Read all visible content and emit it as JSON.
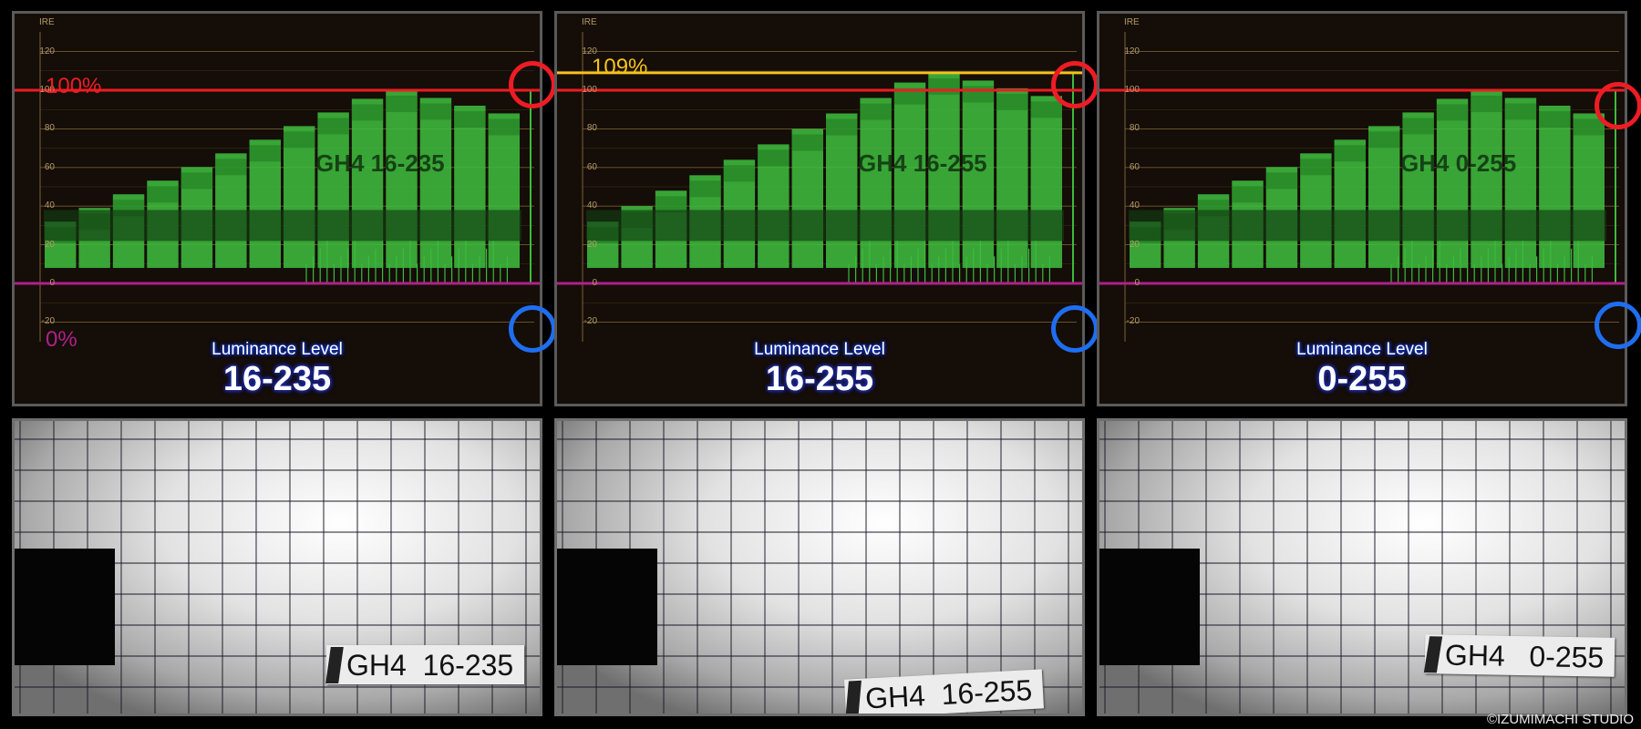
{
  "scope": {
    "axis_title": "IRE",
    "ticks": [
      "120",
      "100",
      "80",
      "60",
      "40",
      "20",
      "0",
      "-20"
    ],
    "luminance_label": "Luminance Level",
    "colors": {
      "waveform": "#3dbb3d",
      "white_line": "#ee1c24",
      "black_line": "#b0208c",
      "over_line": "#f6c21c",
      "grid": "#7a6438",
      "ring_red": "#ee1c24",
      "ring_blue": "#1f6ef0"
    }
  },
  "panels": [
    {
      "luminance_value": "16-235",
      "white_marker_label": "100%",
      "black_marker_label": "0%",
      "scope_text": "GH4 16-235",
      "photo_label": "GH4  16-235",
      "peak_ire": 100
    },
    {
      "luminance_value": "16-255",
      "over_marker_label": "109%",
      "scope_text": "GH4 16-255",
      "photo_label": "GH4  16-255",
      "peak_ire": 109
    },
    {
      "luminance_value": "0-255",
      "scope_text": "GH4 0-255",
      "photo_label": "GH4   0-255",
      "peak_ire": 100
    }
  ],
  "copyright": "©IZUMIMACHI STUDIO"
}
